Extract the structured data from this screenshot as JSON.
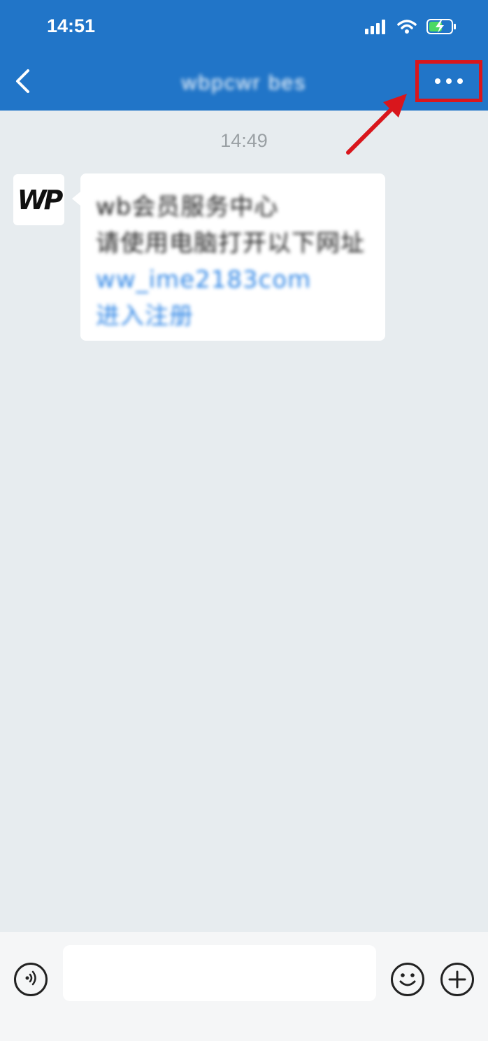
{
  "status_bar": {
    "time": "14:51",
    "icons": [
      "signal-icon",
      "wifi-icon",
      "battery-charging-icon"
    ]
  },
  "nav": {
    "back_icon": "chevron-left-icon",
    "title": "wbpcwr bes",
    "more_icon": "more-dots-icon"
  },
  "chat": {
    "timestamp": "14:49",
    "messages": [
      {
        "sender_avatar": "WP",
        "lines": [
          {
            "text": "wb会员服务中心",
            "style": "dark"
          },
          {
            "text": "请使用电脑打开以下网址",
            "style": "dark"
          },
          {
            "text": "ww_ime2183com",
            "style": "link"
          },
          {
            "text": "进入注册",
            "style": "link"
          }
        ]
      }
    ]
  },
  "input_bar": {
    "voice_icon": "voice-icon",
    "input_value": "",
    "input_placeholder": "",
    "emoji_icon": "emoji-icon",
    "plus_icon": "plus-icon"
  },
  "colors": {
    "header": "#2175c8",
    "background": "#e7ecef",
    "highlight": "#d9161c",
    "link": "#2f86e6"
  }
}
